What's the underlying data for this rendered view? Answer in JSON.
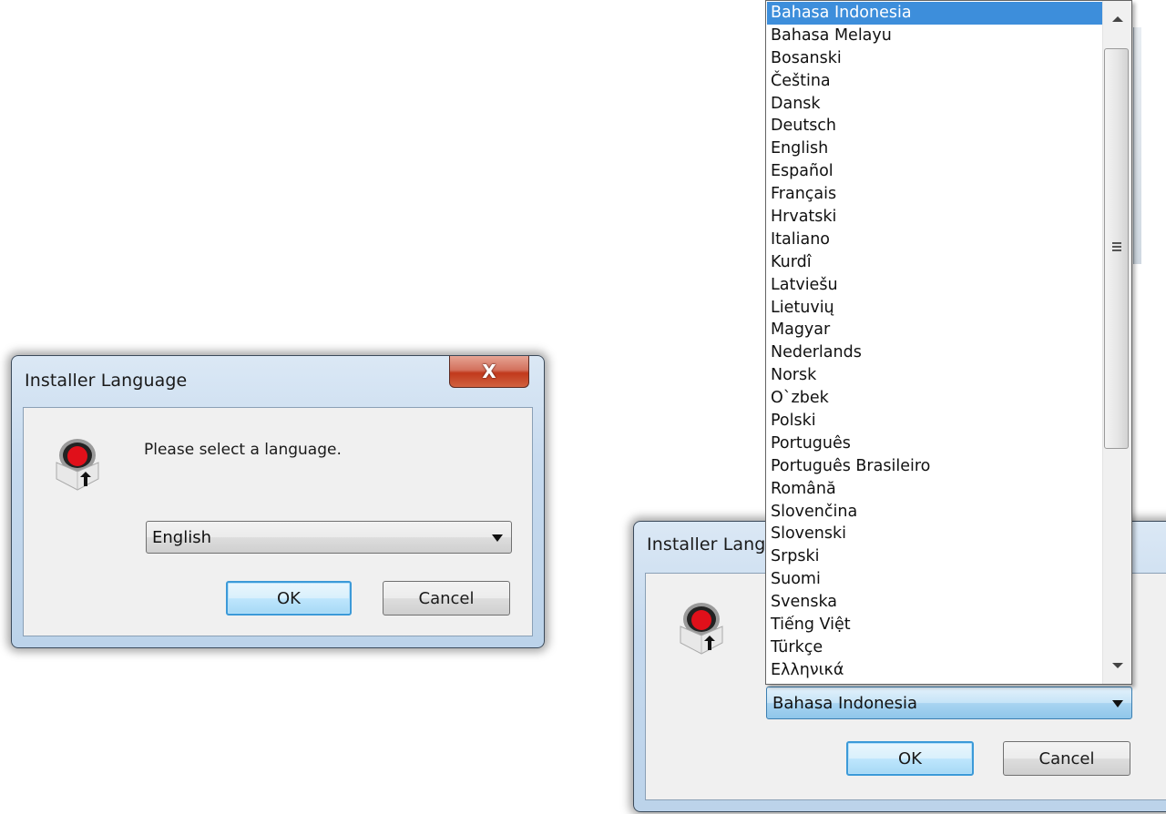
{
  "left_dialog": {
    "title": "Installer Language",
    "close_label": "X",
    "prompt": "Please select a language.",
    "icon": "installer-box-icon",
    "selected_language": "English",
    "ok_label": "OK",
    "cancel_label": "Cancel"
  },
  "right_dialog": {
    "title": "Installer Language",
    "icon": "installer-box-icon",
    "selected_language": "Bahasa Indonesia",
    "ok_label": "OK",
    "cancel_label": "Cancel",
    "dropdown_open": true,
    "highlighted_option": "Bahasa Indonesia",
    "options": [
      "Bahasa Indonesia",
      "Bahasa Melayu",
      "Bosanski",
      "Čeština",
      "Dansk",
      "Deutsch",
      "English",
      "Español",
      "Français",
      "Hrvatski",
      "Italiano",
      "Kurdî",
      "Latviešu",
      "Lietuvių",
      "Magyar",
      "Nederlands",
      "Norsk",
      "O`zbek",
      "Polski",
      "Português",
      "Português Brasileiro",
      "Română",
      "Slovenčina",
      "Slovenski",
      "Srpski",
      "Suomi",
      "Svenska",
      "Tiếng Việt",
      "Türkçe",
      "Ελληνικά"
    ]
  },
  "colors": {
    "selection": "#3d8edb",
    "close_button": "#c1391c",
    "default_button_border": "#3c9ad8"
  }
}
